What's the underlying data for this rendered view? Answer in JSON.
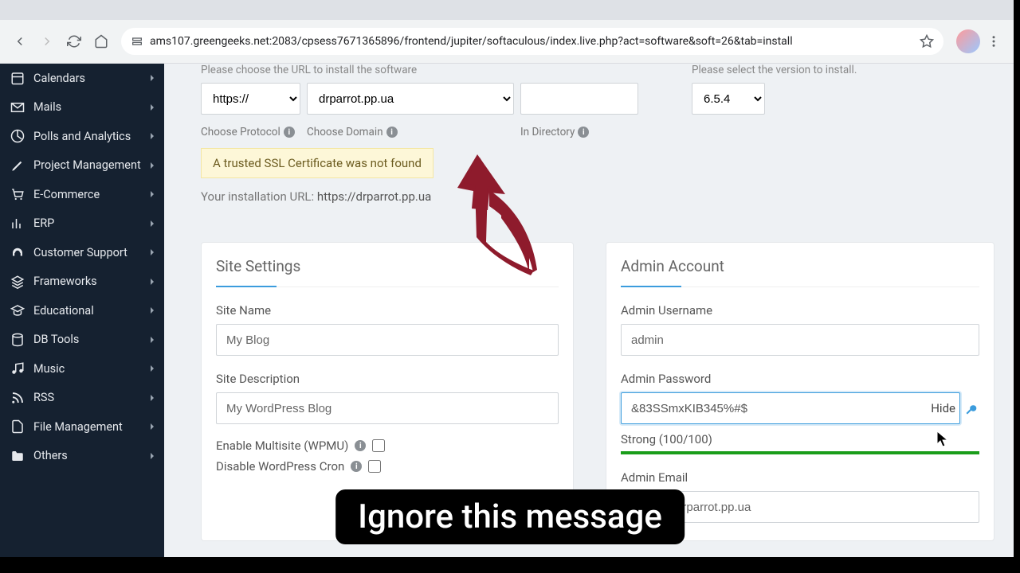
{
  "browser": {
    "url": "ams107.greengeeks.net:2083/cpsess7671365896/frontend/jupiter/softaculous/index.live.php?act=software&soft=26&tab=install"
  },
  "sidebar": {
    "items": [
      {
        "label": "Calendars"
      },
      {
        "label": "Mails"
      },
      {
        "label": "Polls and Analytics"
      },
      {
        "label": "Project Management"
      },
      {
        "label": "E-Commerce"
      },
      {
        "label": "ERP"
      },
      {
        "label": "Customer Support"
      },
      {
        "label": "Frameworks"
      },
      {
        "label": "Educational"
      },
      {
        "label": "DB Tools"
      },
      {
        "label": "Music"
      },
      {
        "label": "RSS"
      },
      {
        "label": "File Management"
      },
      {
        "label": "Others"
      }
    ]
  },
  "install": {
    "url_hint": "Please choose the URL to install the software",
    "version_hint": "Please select the version to install.",
    "protocol": "https://",
    "protocol_label": "Choose Protocol",
    "domain": "drparrot.pp.ua",
    "domain_label": "Choose Domain",
    "directory": "",
    "directory_label": "In Directory",
    "version": "6.5.4",
    "ssl_warning": "A trusted SSL Certificate was not found",
    "install_url_label": "Your installation URL: ",
    "install_url_value": "https://drparrot.pp.ua"
  },
  "site": {
    "card_title": "Site Settings",
    "name_label": "Site Name",
    "name_value": "My Blog",
    "desc_label": "Site Description",
    "desc_value": "My WordPress Blog",
    "multisite_label": "Enable Multisite (WPMU)",
    "cron_label": "Disable WordPress Cron"
  },
  "admin": {
    "card_title": "Admin Account",
    "user_label": "Admin Username",
    "user_value": "admin",
    "pw_label": "Admin Password",
    "pw_value": "&83SSmxKIB345%#$",
    "pw_hide": "Hide",
    "strength_label": "Strong (100/100)",
    "email_label": "Admin Email",
    "email_value": "admin@drparrot.pp.ua"
  },
  "caption": "Ignore this message"
}
